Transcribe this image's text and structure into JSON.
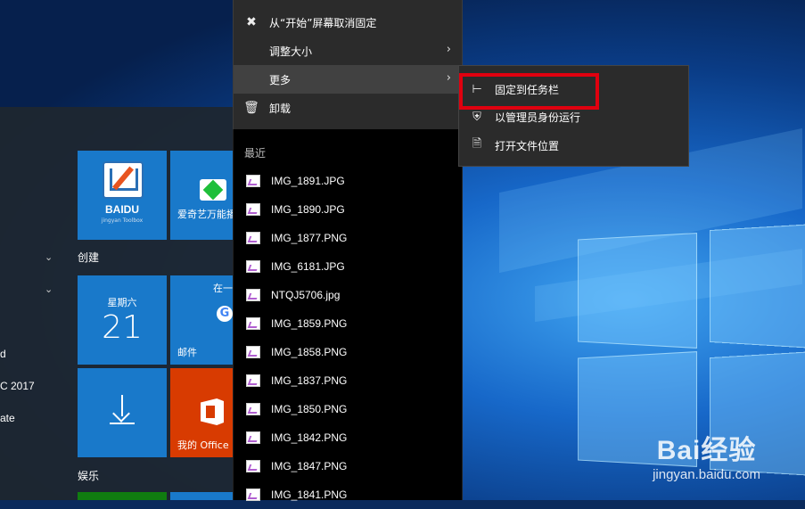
{
  "start_list": {
    "items": [
      "d",
      "C 2017",
      "ate"
    ]
  },
  "groups": {
    "create": "创建",
    "entertainment": "娱乐"
  },
  "tiles": {
    "baidu_title": "BAIDU",
    "baidu_subtitle": "jingyan Toolbox",
    "iqiyi_label": "爱奇艺万能播放器",
    "calendar_day": "星期六",
    "calendar_date": "21",
    "mail_top": "在一",
    "mail_label": "邮件",
    "office_label": "我的 Office"
  },
  "context_menu": {
    "items": [
      {
        "label": "从“开始”屏幕取消固定",
        "icon": "unpin-icon"
      },
      {
        "label": "调整大小",
        "icon": "",
        "has_arrow": true
      },
      {
        "label": "更多",
        "icon": "",
        "has_arrow": true
      },
      {
        "label": "卸载",
        "icon": "trash-icon"
      }
    ],
    "recent_title": "最近",
    "recent_files": [
      "IMG_1891.JPG",
      "IMG_1890.JPG",
      "IMG_1877.PNG",
      "IMG_6181.JPG",
      "NTQJ5706.jpg",
      "IMG_1859.PNG",
      "IMG_1858.PNG",
      "IMG_1837.PNG",
      "IMG_1850.PNG",
      "IMG_1842.PNG",
      "IMG_1847.PNG",
      "IMG_1841.PNG"
    ]
  },
  "submenu": {
    "items": [
      {
        "label": "固定到任务栏",
        "icon": "pin-icon"
      },
      {
        "label": "以管理员身份运行",
        "icon": "shield-icon"
      },
      {
        "label": "打开文件位置",
        "icon": "file-icon"
      }
    ]
  },
  "watermark": {
    "brand": "Bai经验",
    "url": "jingyan.baidu.com"
  },
  "colors": {
    "highlight": "#e0000f",
    "tile_blue": "#1979ca",
    "office_orange": "#d83b01"
  }
}
